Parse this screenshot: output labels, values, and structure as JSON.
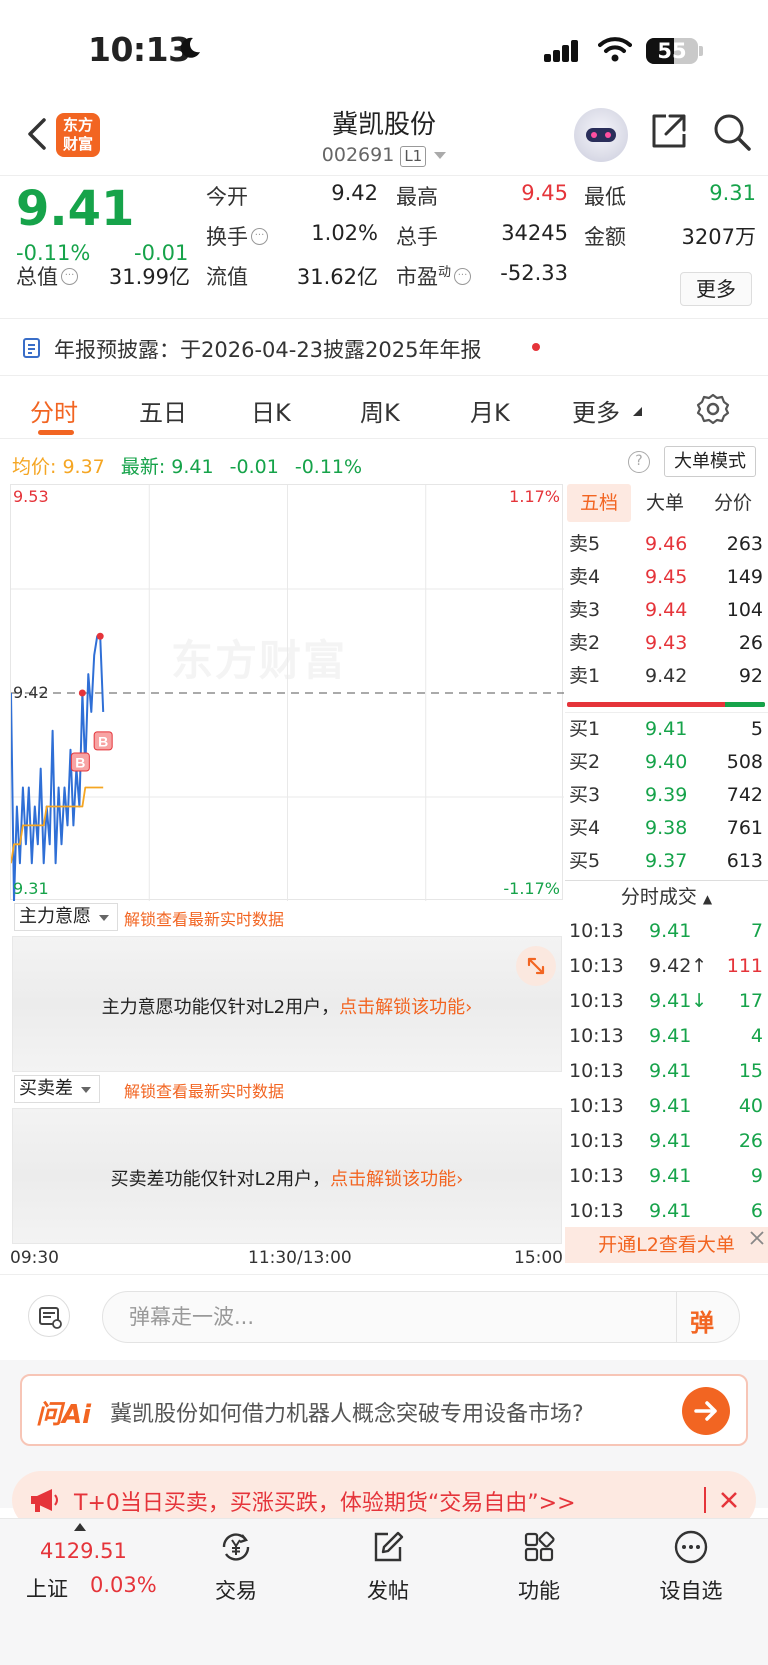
{
  "status_bar": {
    "time": "10:13",
    "battery": "55"
  },
  "header": {
    "stock_name": "冀凯股份",
    "stock_code": "002691",
    "level_badge": "L1",
    "logo_line1": "东方",
    "logo_line2": "财富"
  },
  "quote": {
    "price": "9.41",
    "change_pct": "-0.11%",
    "change_val": "-0.01",
    "open_label": "今开",
    "open": "9.42",
    "high_label": "最高",
    "high": "9.45",
    "low_label": "最低",
    "low": "9.31",
    "turnover_label": "换手",
    "turnover": "1.02%",
    "volume_label": "总手",
    "volume": "34245",
    "amount_label": "金额",
    "amount": "3207万",
    "total_cap_label": "总值",
    "total_cap": "31.99亿",
    "float_cap_label": "流值",
    "float_cap": "31.62亿",
    "pe_label": "市盈",
    "pe_sup": "动",
    "pe": "-52.33",
    "more_label": "更多"
  },
  "notice": {
    "text": "年报预披露：于2026-04-23披露2025年年报"
  },
  "tabs": [
    "分时",
    "五日",
    "日K",
    "周K",
    "月K",
    "更多"
  ],
  "avg_row": {
    "avg_label": "均价:",
    "avg": "9.37",
    "latest_label": "最新:",
    "latest": "9.41",
    "chg": "-0.01",
    "pct": "-0.11%",
    "big_order_mode": "大单模式"
  },
  "chart": {
    "y_top": "9.53",
    "y_mid": "9.42",
    "y_bottom": "9.31",
    "pct_top": "1.17%",
    "pct_bottom": "-1.17%",
    "watermark": "东方财富",
    "x_start": "09:30",
    "x_mid": "11:30/13:00",
    "x_end": "15:00",
    "marker_label": "B"
  },
  "chart_data": {
    "type": "line",
    "title": "",
    "ylim": [
      9.31,
      9.53
    ],
    "prev_close": 9.42,
    "series": [
      {
        "name": "",
        "values": [
          9.42,
          9.31,
          9.36,
          9.33,
          9.37,
          9.34,
          9.37,
          9.33,
          9.36,
          9.34,
          9.38,
          9.33,
          9.36,
          9.34,
          9.4,
          9.33,
          9.37,
          9.34,
          9.37,
          9.35,
          9.39,
          9.35,
          9.38,
          9.36,
          9.42,
          9.38,
          9.43,
          9.41,
          9.44,
          9.45,
          9.45,
          9.41
        ]
      },
      {
        "name": "均价",
        "values": [
          9.33,
          9.34,
          9.34,
          9.34,
          9.35,
          9.35,
          9.35,
          9.35,
          9.35,
          9.35,
          9.35,
          9.35,
          9.36,
          9.36,
          9.36,
          9.36,
          9.36,
          9.36,
          9.36,
          9.36,
          9.36,
          9.36,
          9.36,
          9.36,
          9.36,
          9.37,
          9.37,
          9.37,
          9.37,
          9.37,
          9.37,
          9.37
        ]
      }
    ]
  },
  "panels": {
    "main_force": {
      "select": "主力意愿",
      "unlock": "解锁查看最新实时数据",
      "msg": "主力意愿功能仅针对L2用户，",
      "link": "点击解锁该功能"
    },
    "bid_ask": {
      "select": "买卖差",
      "unlock": "解锁查看最新实时数据",
      "msg": "买卖差功能仅针对L2用户，",
      "link": "点击解锁该功能"
    }
  },
  "order_book": {
    "tabs": [
      "五档",
      "大单",
      "分价"
    ],
    "asks": [
      {
        "label": "卖5",
        "price": "9.46",
        "vol": "263"
      },
      {
        "label": "卖4",
        "price": "9.45",
        "vol": "149"
      },
      {
        "label": "卖3",
        "price": "9.44",
        "vol": "104"
      },
      {
        "label": "卖2",
        "price": "9.43",
        "vol": "26"
      },
      {
        "label": "卖1",
        "price": "9.42",
        "vol": "92"
      }
    ],
    "bids": [
      {
        "label": "买1",
        "price": "9.41",
        "vol": "5"
      },
      {
        "label": "买2",
        "price": "9.40",
        "vol": "508"
      },
      {
        "label": "买3",
        "price": "9.39",
        "vol": "742"
      },
      {
        "label": "买4",
        "price": "9.38",
        "vol": "761"
      },
      {
        "label": "买5",
        "price": "9.37",
        "vol": "613"
      }
    ],
    "ticks_header": "分时成交",
    "ticks": [
      {
        "time": "10:13",
        "price": "9.41",
        "vol": "7",
        "dir": ""
      },
      {
        "time": "10:13",
        "price": "9.42↑",
        "vol": "111",
        "dir": "up"
      },
      {
        "time": "10:13",
        "price": "9.41↓",
        "vol": "17",
        "dir": "down"
      },
      {
        "time": "10:13",
        "price": "9.41",
        "vol": "4",
        "dir": ""
      },
      {
        "time": "10:13",
        "price": "9.41",
        "vol": "15",
        "dir": ""
      },
      {
        "time": "10:13",
        "price": "9.41",
        "vol": "40",
        "dir": ""
      },
      {
        "time": "10:13",
        "price": "9.41",
        "vol": "26",
        "dir": ""
      },
      {
        "time": "10:13",
        "price": "9.41",
        "vol": "9",
        "dir": ""
      },
      {
        "time": "10:13",
        "price": "9.41",
        "vol": "6",
        "dir": ""
      }
    ],
    "l2_banner": "开通L2查看大单"
  },
  "danmu": {
    "placeholder": "弹幕走一波...",
    "toggle": "弹"
  },
  "ai": {
    "logo": "问Ai",
    "question": "冀凯股份如何借力机器人概念突破专用设备市场?"
  },
  "promo": {
    "text": "T+0当日买卖，买涨买跌，体验期货“交易自由”>>"
  },
  "bottom_nav": {
    "index_value": "4129.51",
    "index_name": "上证",
    "index_change": "0.03%",
    "items": [
      "交易",
      "发帖",
      "功能",
      "设自选"
    ]
  },
  "colors": {
    "up": "#e5343a",
    "down": "#16a34a",
    "accent": "#f26522",
    "avg_line": "#f5a623",
    "price_line": "#2f6fd6"
  }
}
